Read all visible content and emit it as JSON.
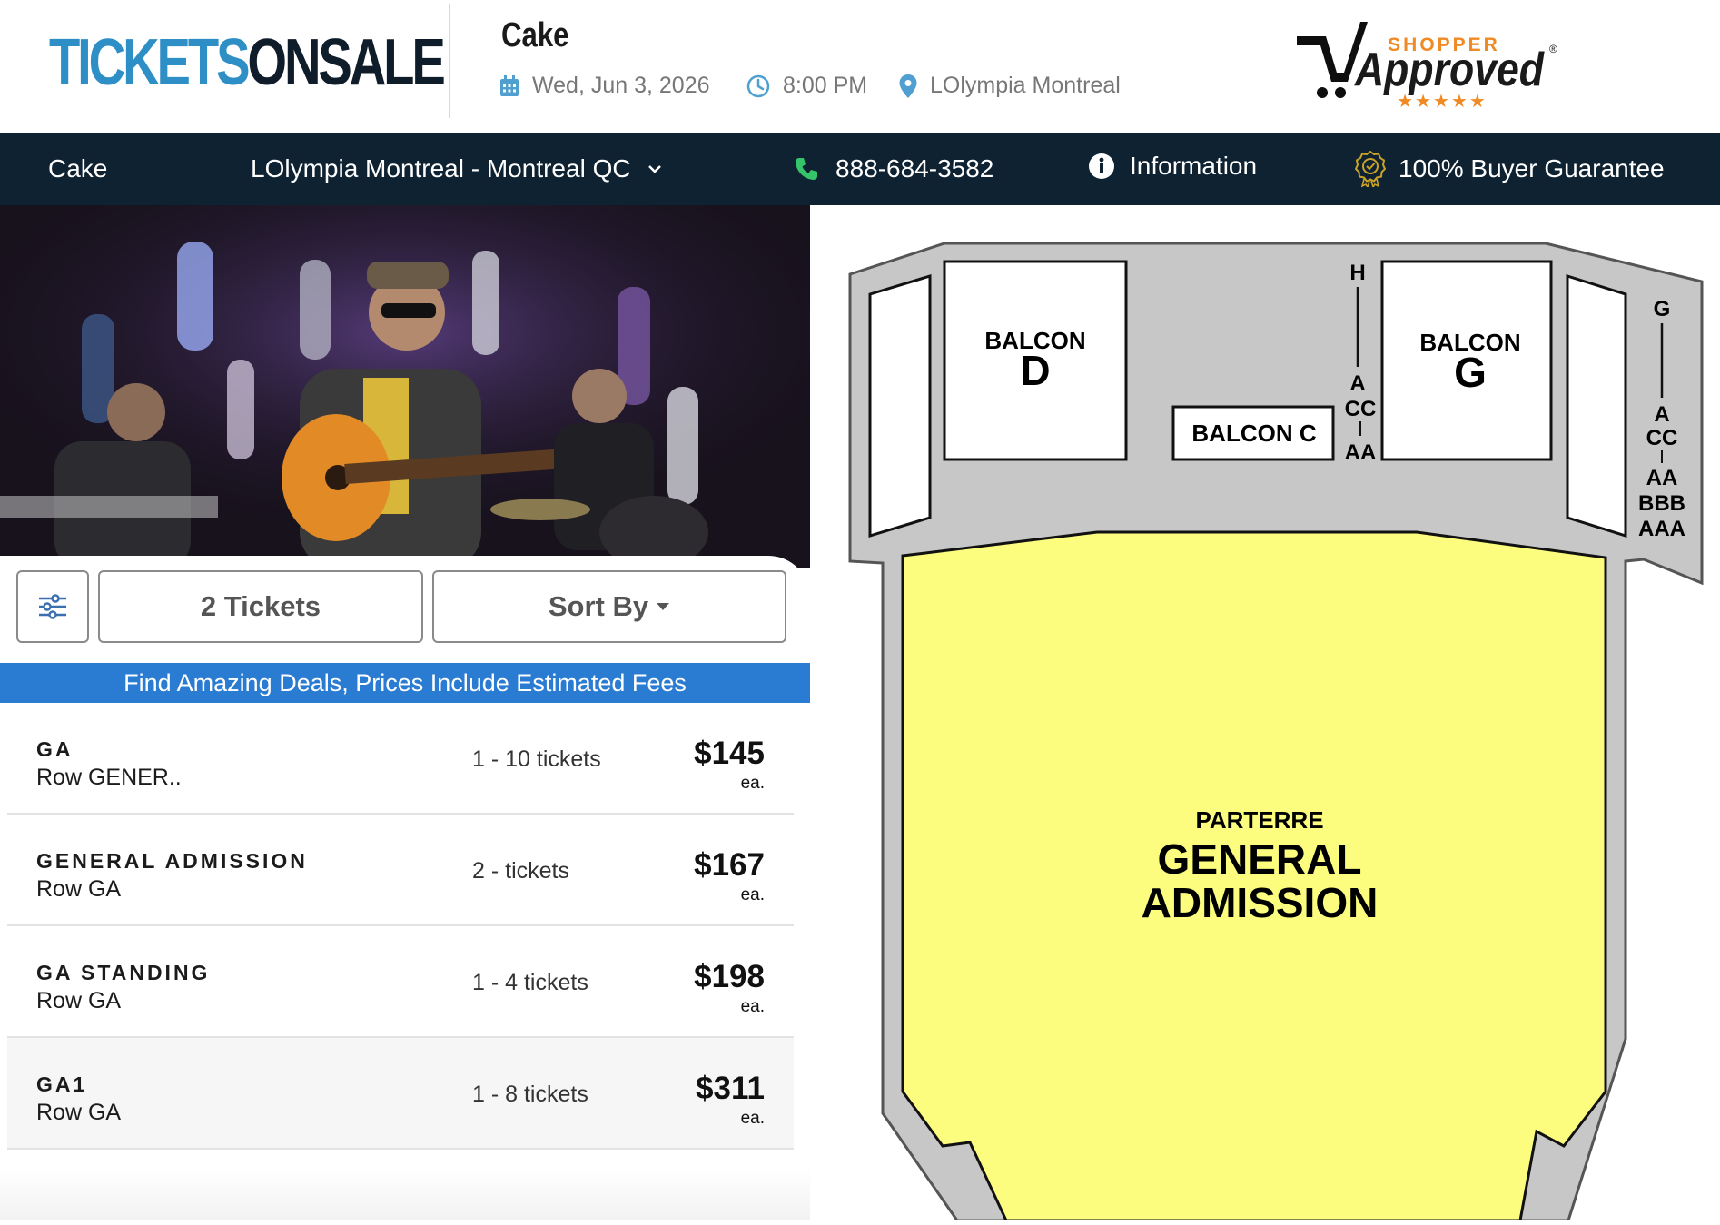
{
  "header": {
    "logo_part1": "TICKETS",
    "logo_part2": "ONSALE",
    "event_title": "Cake",
    "date": "Wed, Jun 3, 2026",
    "time": "8:00 PM",
    "venue": "LOlympia Montreal",
    "badge": {
      "top": "SHOPPER",
      "main": "Approved",
      "stars": "★★★★★"
    }
  },
  "navbar": {
    "event": "Cake",
    "venue_select": "LOlympia Montreal - Montreal QC",
    "phone": "888-684-3582",
    "information": "Information",
    "guarantee": "100% Buyer Guarantee"
  },
  "controls": {
    "tickets_label": "2 Tickets",
    "sort_label": "Sort By"
  },
  "promo_banner": "Find Amazing Deals, Prices Include Estimated Fees",
  "listings": [
    {
      "section": "GA",
      "row": "Row GENER..",
      "qty": "1 - 10 tickets",
      "price": "$145",
      "unit": "ea."
    },
    {
      "section": "GENERAL ADMISSION",
      "row": "Row GA",
      "qty": "2 - tickets",
      "price": "$167",
      "unit": "ea."
    },
    {
      "section": "GA STANDING",
      "row": "Row GA",
      "qty": "1 - 4 tickets",
      "price": "$198",
      "unit": "ea."
    },
    {
      "section": "GA1",
      "row": "Row GA",
      "qty": "1 - 8 tickets",
      "price": "$311",
      "unit": "ea."
    }
  ],
  "map": {
    "balcon_d_label": "BALCON",
    "balcon_d_letter": "D",
    "balcon_g_label": "BALCON",
    "balcon_g_letter": "G",
    "balcon_c": "BALCON C",
    "left_rows": [
      "H",
      "A",
      "CC",
      "AA"
    ],
    "right_rows": [
      "G",
      "A",
      "CC",
      "AA",
      "BBB",
      "AAA"
    ],
    "parterre": "PARTERRE",
    "ga_line1": "GENERAL",
    "ga_line2": "ADMISSION"
  },
  "colors": {
    "brand_blue": "#2e8fc6",
    "navbar_bg": "#0f2231",
    "promo_bg": "#2a7bd2",
    "floor_yellow": "#fcfc7e",
    "balcony_gray": "#c7c7c7",
    "shopper_orange": "#f08a24"
  },
  "icons": [
    "calendar-icon",
    "clock-icon",
    "location-pin-icon",
    "phone-icon",
    "info-icon",
    "award-badge-icon",
    "chevron-down-icon",
    "filter-sliders-icon",
    "caret-down-icon"
  ]
}
